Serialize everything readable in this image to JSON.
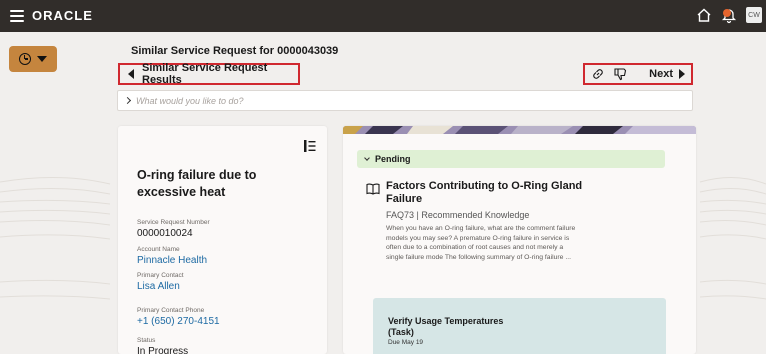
{
  "header": {
    "brand": "ORACLE",
    "avatar_initials": "CW"
  },
  "page": {
    "title": "Similar Service Request for 0000043039",
    "back_label": "Similar Service Request Results",
    "next_label": "Next",
    "ask_placeholder": "What would you like to do?"
  },
  "left_card": {
    "title": "O-ring failure due to excessive heat",
    "fields": [
      {
        "label": "Service Request Number",
        "value": "0000010024"
      },
      {
        "label": "Account Name",
        "value": "Pinnacle Health"
      },
      {
        "label": "Primary Contact",
        "value": "Lisa Allen"
      },
      {
        "label": "Primary Contact Phone",
        "value": "+1 (650) 270-4151"
      },
      {
        "label": "Status",
        "value": "In Progress"
      }
    ]
  },
  "right_card": {
    "pending_label": "Pending",
    "article": {
      "title": "Factors Contributing to O-Ring Gland Failure",
      "meta": "FAQ73 | Recommended Knowledge",
      "summary": "When you have an O-ring failure, what are the comment failure models you may see? A premature O-ring failure in service is often due to a combination of root causes and not merely a single failure mode The following summary of O-ring failure ..."
    },
    "task": {
      "title": "Verify Usage Temperatures (Task)",
      "due": "Due May 19"
    }
  },
  "colors": {
    "topbar": "#312d2a",
    "clock_button": "#c5853e",
    "highlight_border": "#d0282f",
    "link": "#1d6aa3",
    "pending_bg": "#dff0d4",
    "task_bg": "#d6e6e6"
  }
}
